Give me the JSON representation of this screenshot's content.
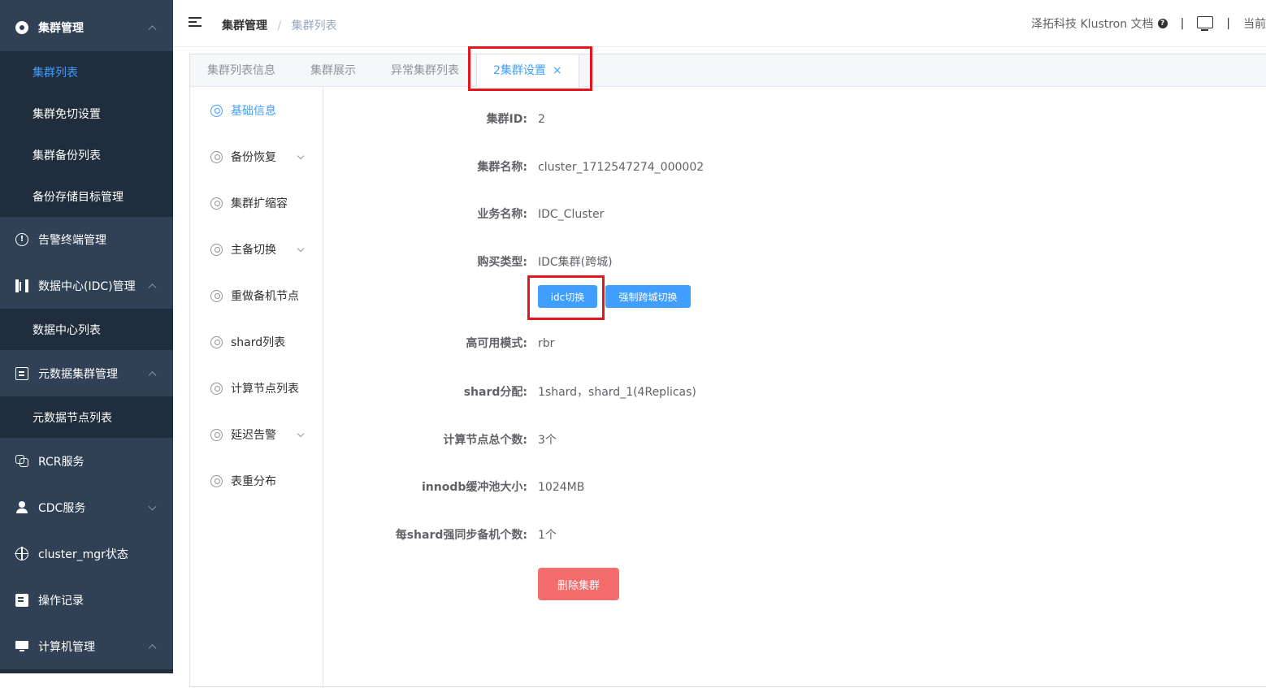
{
  "sidebar": {
    "groups": [
      {
        "label": "集群管理",
        "icon": "settings-icon"
      },
      {
        "label": "告警终端管理",
        "icon": "alert-circle-icon"
      },
      {
        "label": "数据中心(IDC)管理",
        "icon": "datacenter-icon"
      },
      {
        "label": "元数据集群管理",
        "icon": "metadata-icon"
      },
      {
        "label": "RCR服务",
        "icon": "link-icon"
      },
      {
        "label": "CDC服务",
        "icon": "user-icon"
      },
      {
        "label": "cluster_mgr状态",
        "icon": "crosshair-icon"
      },
      {
        "label": "操作记录",
        "icon": "document-icon"
      },
      {
        "label": "计算机管理",
        "icon": "monitor-icon"
      }
    ],
    "cluster_sub": [
      "集群列表",
      "集群免切设置",
      "集群备份列表",
      "备份存储目标管理"
    ],
    "idc_sub": [
      "数据中心列表"
    ],
    "meta_sub": [
      "元数据节点列表"
    ]
  },
  "header": {
    "breadcrumb_1": "集群管理",
    "breadcrumb_sep": "/",
    "breadcrumb_2": "集群列表",
    "docs_link": "泽拓科技 Klustron 文档",
    "help_glyph": "?",
    "divider": "|",
    "current_user_prefix": "当前"
  },
  "tabs": [
    {
      "label": "集群列表信息"
    },
    {
      "label": "集群展示"
    },
    {
      "label": "异常集群列表"
    },
    {
      "label": "2集群设置",
      "close": "×"
    }
  ],
  "side_menu": [
    {
      "label": "基础信息",
      "expandable": false
    },
    {
      "label": "备份恢复",
      "expandable": true
    },
    {
      "label": "集群扩缩容",
      "expandable": false
    },
    {
      "label": "主备切换",
      "expandable": true
    },
    {
      "label": "重做备机节点",
      "expandable": false
    },
    {
      "label": "shard列表",
      "expandable": false
    },
    {
      "label": "计算节点列表",
      "expandable": false
    },
    {
      "label": "延迟告警",
      "expandable": true
    },
    {
      "label": "表重分布",
      "expandable": false
    }
  ],
  "form": {
    "cluster_id": {
      "label": "集群ID:",
      "value": "2"
    },
    "cluster_name": {
      "label": "集群名称:",
      "value": "cluster_1712547274_000002"
    },
    "business_name": {
      "label": "业务名称:",
      "value": "IDC_Cluster"
    },
    "purchase_type": {
      "label": "购买类型:",
      "value": "IDC集群(跨城)"
    },
    "ha_mode": {
      "label": "高可用模式:",
      "value": "rbr"
    },
    "shard_alloc": {
      "label": "shard分配:",
      "value": "1shard，shard_1(4Replicas)"
    },
    "compute_nodes": {
      "label": "计算节点总个数:",
      "value": "3个"
    },
    "innodb_pool": {
      "label": "innodb缓冲池大小:",
      "value": "1024MB"
    },
    "sync_standby": {
      "label": "每shard强同步备机个数:",
      "value": "1个"
    }
  },
  "buttons": {
    "idc_switch": "idc切换",
    "force_cross_city_switch": "强制跨城切换",
    "delete_cluster": "删除集群"
  },
  "colors": {
    "sidebar_bg": "#304156",
    "submenu_bg": "#1f2d3d",
    "primary": "#409eff",
    "danger": "#f56c6c",
    "highlight_box": "#e8141b"
  }
}
